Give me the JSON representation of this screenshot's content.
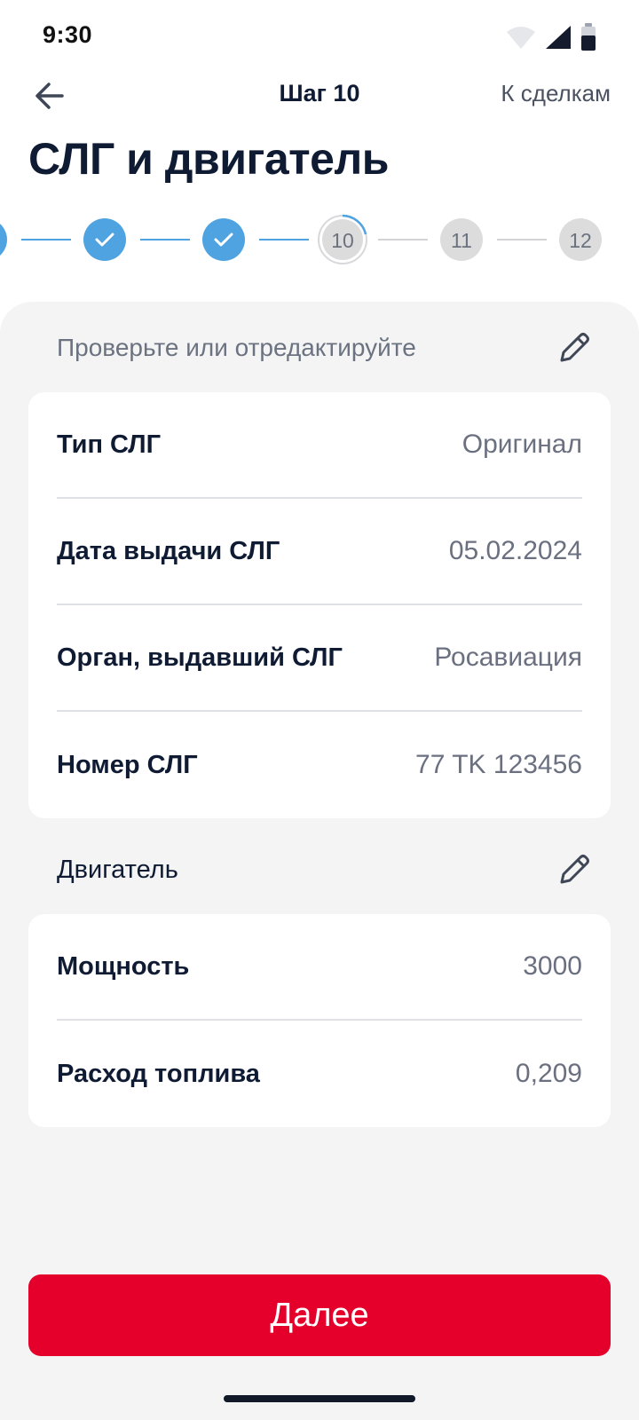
{
  "status_bar": {
    "time": "9:30",
    "icons": [
      "wifi-icon",
      "signal-icon",
      "battery-icon"
    ]
  },
  "header": {
    "back_icon": "arrow-left-icon",
    "step_title": "Шаг 10",
    "to_deals_label": "К сделкам"
  },
  "page_title": "СЛГ и двигатель",
  "stepper": {
    "steps": [
      {
        "label": "",
        "state": "done"
      },
      {
        "label": "",
        "state": "done"
      },
      {
        "label": "",
        "state": "done"
      },
      {
        "label": "10",
        "state": "current"
      },
      {
        "label": "11",
        "state": "upcoming"
      },
      {
        "label": "12",
        "state": "upcoming"
      }
    ],
    "colors": {
      "done": "#4fa3e0",
      "upcoming": "#dcdcdc"
    }
  },
  "slg_section": {
    "hint": "Проверьте или отредактируйте",
    "edit_icon": "pencil-icon",
    "rows": [
      {
        "label": "Тип СЛГ",
        "value": "Оригинал"
      },
      {
        "label": "Дата выдачи СЛГ",
        "value": "05.02.2024"
      },
      {
        "label": "Орган, выдавший СЛГ",
        "value": "Росавиация"
      },
      {
        "label": "Номер СЛГ",
        "value": "77 TK 123456"
      }
    ]
  },
  "engine_section": {
    "title": "Двигатель",
    "edit_icon": "pencil-icon",
    "rows": [
      {
        "label": "Мощность",
        "value": "3000"
      },
      {
        "label": "Расход топлива",
        "value": "0,209"
      }
    ]
  },
  "next_button_label": "Далее",
  "colors": {
    "accent_red": "#e4002b",
    "accent_blue": "#4fa3e0",
    "text_primary": "#0f1b33",
    "panel_bg": "#f4f4f5"
  }
}
